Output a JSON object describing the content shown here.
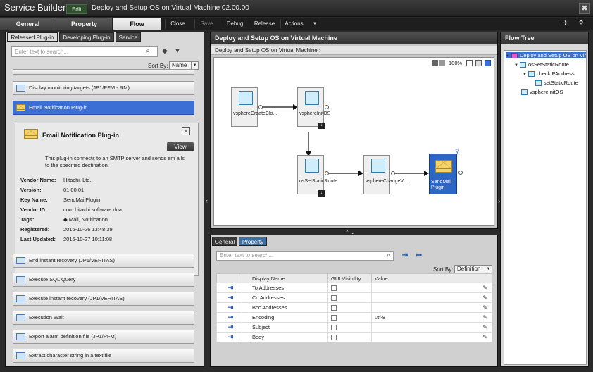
{
  "app": {
    "title": "Service Builder",
    "mode_badge": "Edit",
    "document_title": "Deploy and Setup OS on Virtual Machine 02.00.00",
    "close_icon": "✖"
  },
  "tabs": [
    {
      "label": "General"
    },
    {
      "label": "Property"
    },
    {
      "label": "Flow"
    }
  ],
  "toolbar": {
    "close": "Close",
    "save": "Save",
    "debug": "Debug",
    "release": "Release",
    "actions": "Actions",
    "actions_caret": "▼",
    "pin_icon": "✈",
    "help_icon": "?"
  },
  "left_panel": {
    "tabs": [
      "Released Plug-in",
      "Developing Plug-in",
      "Service"
    ],
    "search_placeholder": "Enter text to search...",
    "sort_label": "Sort By:",
    "sort_value": "Name",
    "items_top": [
      {
        "label": "Display monitoring targets (JP1/PFM - RM)"
      },
      {
        "label": "Email Notification Plug-in"
      }
    ],
    "items_bottom": [
      {
        "label": "End instant recovery (JP1/VERITAS)"
      },
      {
        "label": "Execute SQL Query"
      },
      {
        "label": "Execute instant recovery (JP1/VERITAS)"
      },
      {
        "label": "Execution Wait"
      },
      {
        "label": "Export alarm definition file (JP1/PFM)"
      },
      {
        "label": "Extract character string in a text file"
      }
    ],
    "detail": {
      "title": "Email Notification Plug-in",
      "view_button": "View",
      "close_label": "x",
      "description": "This plug-in connects to an SMTP server and sends em ails to the specified destination.",
      "fields": [
        {
          "label": "Vendor Name:",
          "value": "Hitachi, Ltd."
        },
        {
          "label": "Version:",
          "value": "01.00.01"
        },
        {
          "label": "Key Name:",
          "value": "SendMailPlugin"
        },
        {
          "label": "Vendor ID:",
          "value": "com.hitachi.software.dna"
        },
        {
          "label": "Tags:",
          "value": "Mail, Notification"
        },
        {
          "label": "Registered:",
          "value": "2016-10-26 13:48:39"
        },
        {
          "label": "Last Updated:",
          "value": "2016-10-27 10:11:08"
        }
      ]
    }
  },
  "center_panel": {
    "title": "Deploy and Setup OS on Virtual Machine",
    "breadcrumb": "Deploy and Setup OS on Virtual Machine",
    "zoom": "100%",
    "nodes": [
      {
        "label": "vsphereCreateClo..."
      },
      {
        "label": "vsphereInitOS"
      },
      {
        "label": "osSetStaticRoute"
      },
      {
        "label": "vsphereChangeV..."
      },
      {
        "label": "SendMail Plugin"
      }
    ]
  },
  "bottom_panel": {
    "tabs": [
      "General",
      "Property"
    ],
    "search_placeholder": "Enter text to search...",
    "sort_label": "Sort By:",
    "sort_value": "Definition",
    "columns": [
      "Display Name",
      "GUI Visibility",
      "Value"
    ],
    "rows": [
      {
        "name": "To Addresses",
        "value": ""
      },
      {
        "name": "Cc Addresses",
        "value": ""
      },
      {
        "name": "Bcc Addresses",
        "value": ""
      },
      {
        "name": "Encoding",
        "value": "utf-8"
      },
      {
        "name": "Subject",
        "value": ""
      },
      {
        "name": "Body",
        "value": ""
      }
    ]
  },
  "right_panel": {
    "title": "Flow Tree",
    "items": [
      {
        "label": "Deploy and Setup OS on Virtual Machine"
      },
      {
        "label": "osSetStaticRoute"
      },
      {
        "label": "checkIPAddress"
      },
      {
        "label": "setStaticRoute"
      },
      {
        "label": "vsphereInitOS"
      }
    ]
  }
}
